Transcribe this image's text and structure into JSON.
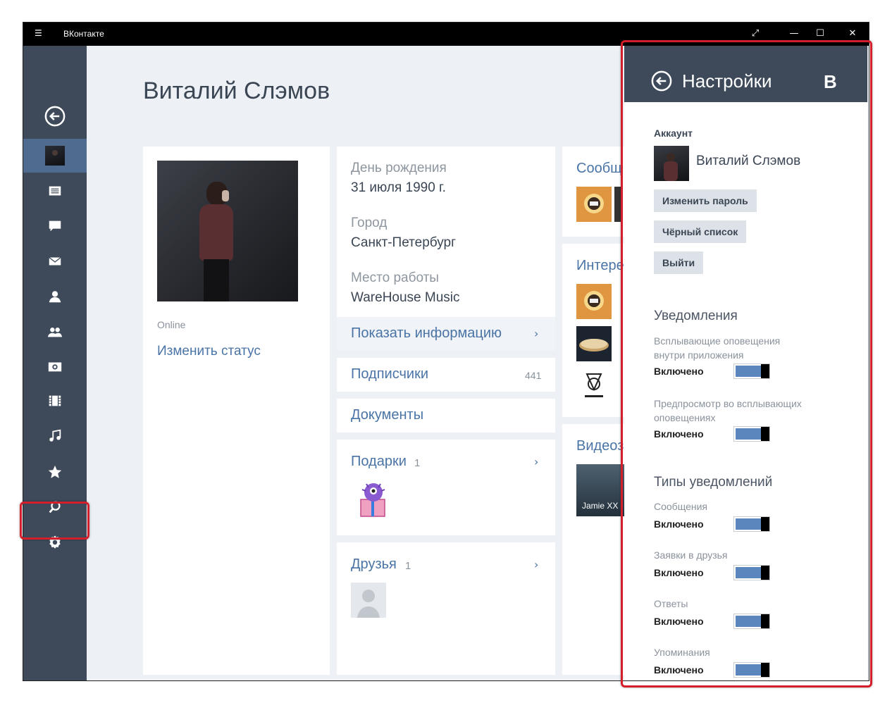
{
  "app": {
    "title": "ВКонтакте"
  },
  "profile": {
    "name": "Виталий Слэмов",
    "online": "Online",
    "change_status": "Изменить статус"
  },
  "info": {
    "birthday_label": "День рождения",
    "birthday_value": "31 июля 1990 г.",
    "city_label": "Город",
    "city_value": "Санкт-Петербург",
    "work_label": "Место работы",
    "work_value": "WareHouse Music",
    "show_info": "Показать информацию"
  },
  "followers": {
    "label": "Подписчики",
    "count": "441"
  },
  "documents": {
    "label": "Документы"
  },
  "gifts": {
    "label": "Подарки",
    "count": "1"
  },
  "friends": {
    "label": "Друзья",
    "count": "1"
  },
  "right_column": {
    "communities": "Сообщ",
    "interests": "Интере",
    "videos": "Видеоз",
    "video_caption": "Jamie XX -"
  },
  "settings": {
    "title": "Настройки",
    "logo": "B",
    "account_heading": "Аккаунт",
    "account_name": "Виталий Слэмов",
    "change_password": "Изменить пароль",
    "blacklist": "Чёрный список",
    "logout": "Выйти",
    "notifications_heading": "Уведомления",
    "popup_label": "Всплывающие оповещения внутри приложения",
    "popup_state": "Включено",
    "preview_label": "Предпросмотр во всплывающих оповещениях",
    "preview_state": "Включено",
    "types_heading": "Типы уведомлений",
    "messages_label": "Сообщения",
    "messages_state": "Включено",
    "friend_requests_label": "Заявки в друзья",
    "friend_requests_state": "Включено",
    "replies_label": "Ответы",
    "replies_state": "Включено",
    "mentions_label": "Упоминания",
    "mentions_state": "Включено"
  },
  "sidebar_icons": [
    "back-icon",
    "profile-avatar",
    "news-icon",
    "comments-icon",
    "messages-icon",
    "user-icon",
    "groups-icon",
    "photos-icon",
    "video-icon",
    "music-icon",
    "favorites-icon",
    "search-icon",
    "settings-icon"
  ],
  "colors": {
    "sidebar": "#3e4a5a",
    "active_item": "#4f6c90",
    "link": "#4a74a6",
    "toggle_on": "#5b86bd",
    "highlight": "#d21f2b"
  }
}
